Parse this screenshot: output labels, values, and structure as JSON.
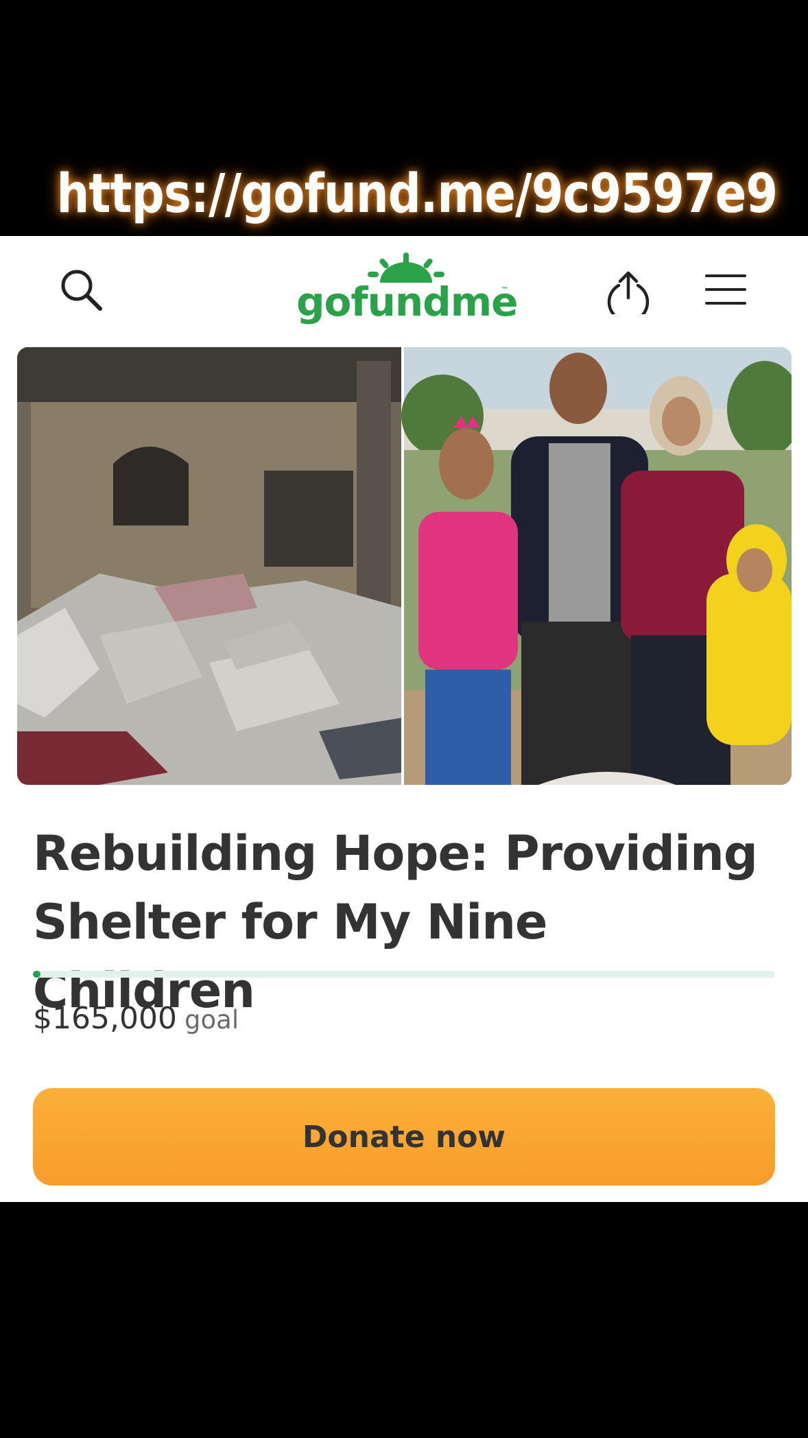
{
  "banner": {
    "url": "https://gofund.me/9c9597e9"
  },
  "header": {
    "logo_text": "gofundme",
    "logo_tm": "™",
    "icons": [
      "search-icon",
      "share-icon",
      "menu-icon"
    ]
  },
  "campaign": {
    "title": "Rebuilding Hope: Providing Shelter for My Nine Children",
    "goal_amount": "$165,000",
    "goal_label": "goal",
    "progress_fraction": 0.01,
    "donate_label": "Donate now"
  },
  "colors": {
    "brand_green": "#2aa24a",
    "donate_orange": "#f9a633",
    "progress_track": "#e2f1ea"
  }
}
